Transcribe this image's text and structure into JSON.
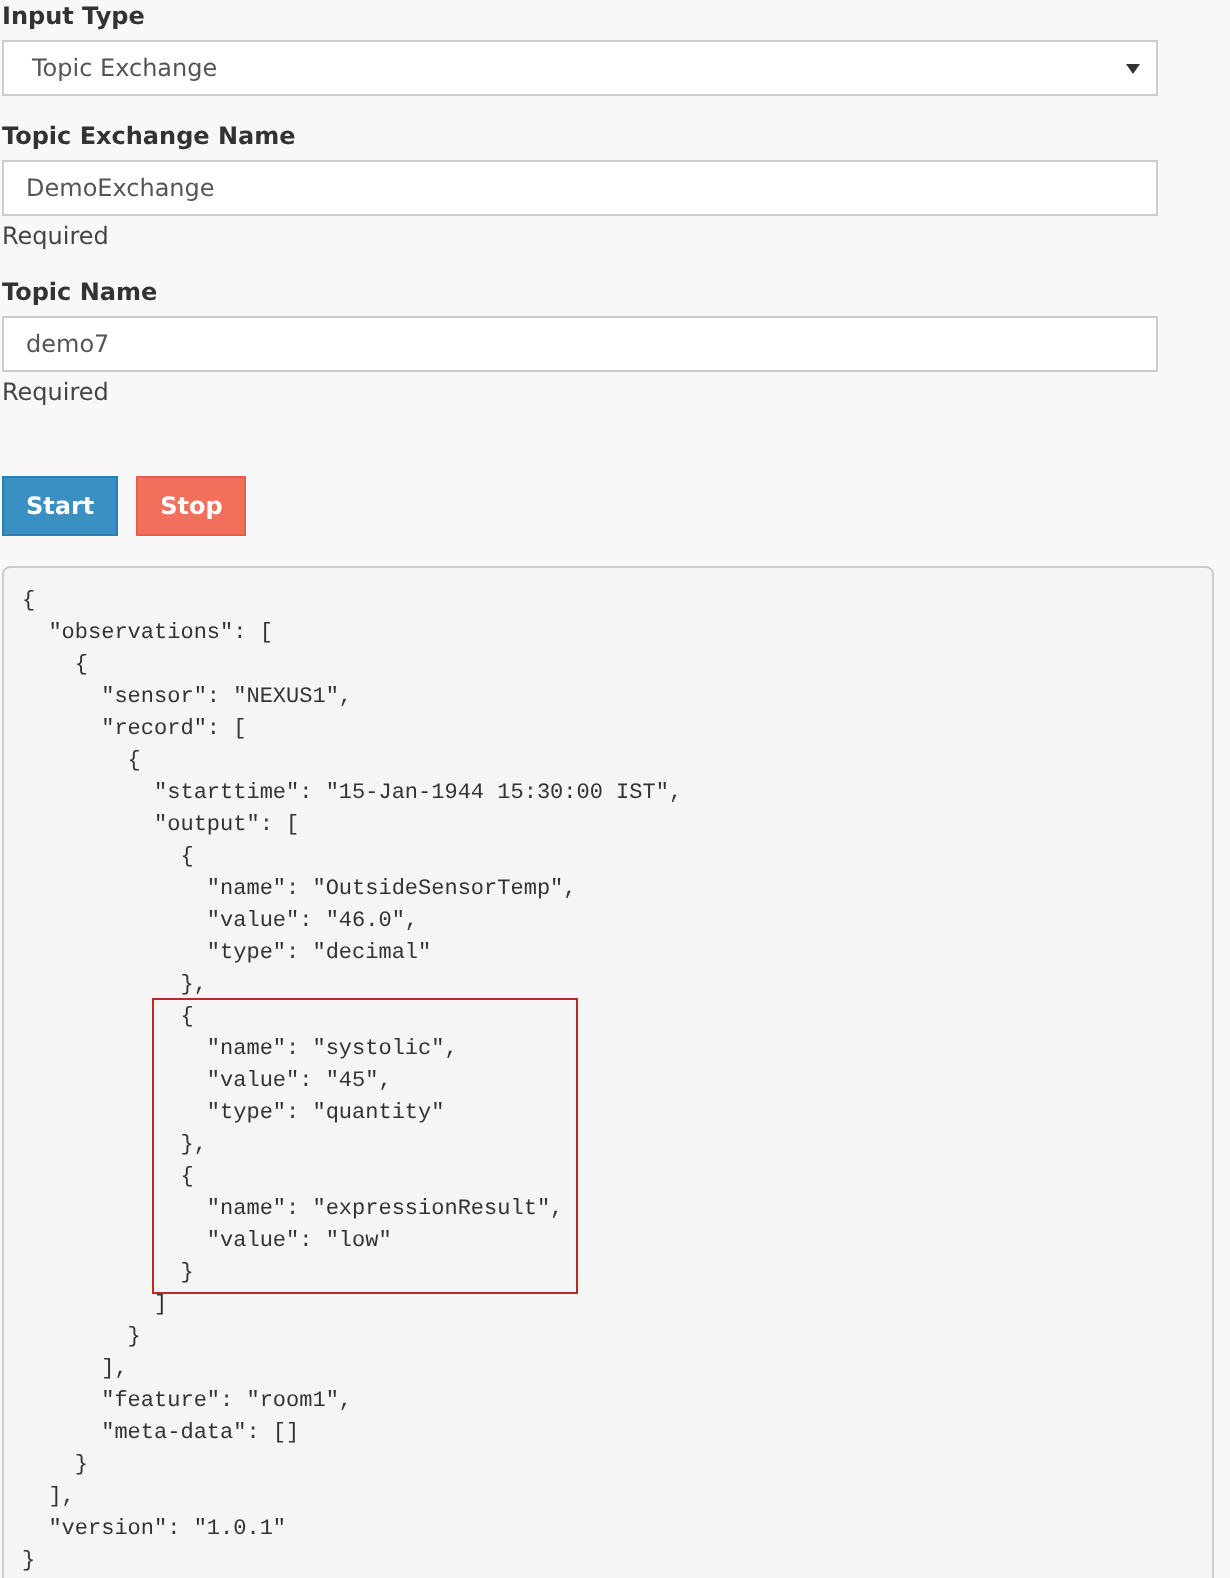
{
  "form": {
    "fields": [
      {
        "kind": "select",
        "label": "Input Type",
        "value": "Topic Exchange"
      },
      {
        "kind": "text",
        "label": "Topic Exchange Name",
        "value": "DemoExchange",
        "help": "Required"
      },
      {
        "kind": "text",
        "label": "Topic Name",
        "value": "demo7",
        "help": "Required"
      }
    ],
    "buttons": [
      {
        "label": "Start",
        "kind": "primary"
      },
      {
        "label": "Stop",
        "kind": "danger"
      }
    ]
  },
  "output": {
    "blocks": [
      {
        "highlighted": false,
        "lines": [
          "{",
          "  \"observations\": [",
          "    {",
          "      \"sensor\": \"NEXUS1\",",
          "      \"record\": [",
          "        {",
          "          \"starttime\": \"15-Jan-1944 15:30:00 IST\",",
          "          \"output\": [",
          "            {",
          "              \"name\": \"OutsideSensorTemp\",",
          "              \"value\": \"46.0\",",
          "              \"type\": \"decimal\"",
          "            },"
        ]
      },
      {
        "highlighted": true,
        "lines": [
          "            {",
          "              \"name\": \"systolic\",",
          "              \"value\": \"45\",",
          "              \"type\": \"quantity\"",
          "            },",
          "            {",
          "              \"name\": \"expressionResult\",",
          "              \"value\": \"low\"",
          "            }"
        ]
      },
      {
        "highlighted": false,
        "lines": [
          "          ]",
          "        }",
          "      ],",
          "      \"feature\": \"room1\",",
          "      \"meta-data\": []",
          "    }",
          "  ],",
          "  \"version\": \"1.0.1\"",
          "}"
        ]
      }
    ]
  }
}
